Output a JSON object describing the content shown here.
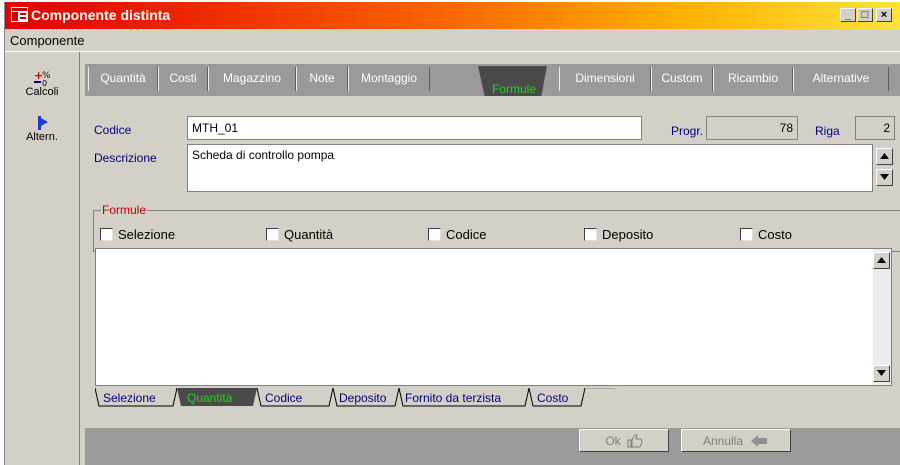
{
  "window": {
    "title": "Componente distinta",
    "controls": {
      "minimize": "_",
      "maximize": "□",
      "close": "×"
    }
  },
  "menu": {
    "items": [
      "Componente"
    ]
  },
  "toolbar": {
    "calcoli_label": "Calcoli",
    "altern_label": "Altern."
  },
  "tabs": [
    {
      "label": "Quantità"
    },
    {
      "label": "Costi"
    },
    {
      "label": "Magazzino"
    },
    {
      "label": "Note"
    },
    {
      "label": "Montaggio"
    },
    {
      "label": "Formule",
      "active": true
    },
    {
      "label": "Dimensioni"
    },
    {
      "label": "Custom"
    },
    {
      "label": "Ricambio"
    },
    {
      "label": "Alternative"
    }
  ],
  "form": {
    "codice_label": "Codice",
    "codice_value": "MTH_01",
    "progr_label": "Progr.",
    "progr_value": "78",
    "riga_label": "Riga",
    "riga_value": "2",
    "descrizione_label": "Descrizione",
    "descrizione_value": "Scheda di controllo pompa"
  },
  "formule": {
    "legend": "Formule",
    "checkboxes": [
      {
        "label": "Selezione",
        "checked": false
      },
      {
        "label": "Quantità",
        "checked": false
      },
      {
        "label": "Codice",
        "checked": false
      },
      {
        "label": "Deposito",
        "checked": false
      },
      {
        "label": "Costo",
        "checked": false
      }
    ]
  },
  "bottom_tabs": [
    {
      "label": "Selezione"
    },
    {
      "label": "Quantità",
      "active": true
    },
    {
      "label": "Codice"
    },
    {
      "label": "Deposito"
    },
    {
      "label": "Fornito da terzista"
    },
    {
      "label": "Costo"
    }
  ],
  "buttons": {
    "ok_label": "Ok",
    "annulla_label": "Annulla"
  },
  "colors": {
    "label_blue": "#000080",
    "active_tab_green": "#1fd41f",
    "legend_red": "#c00000",
    "panel_gray": "#d4d0c8",
    "tab_bar_gray": "#9a9a9a"
  }
}
